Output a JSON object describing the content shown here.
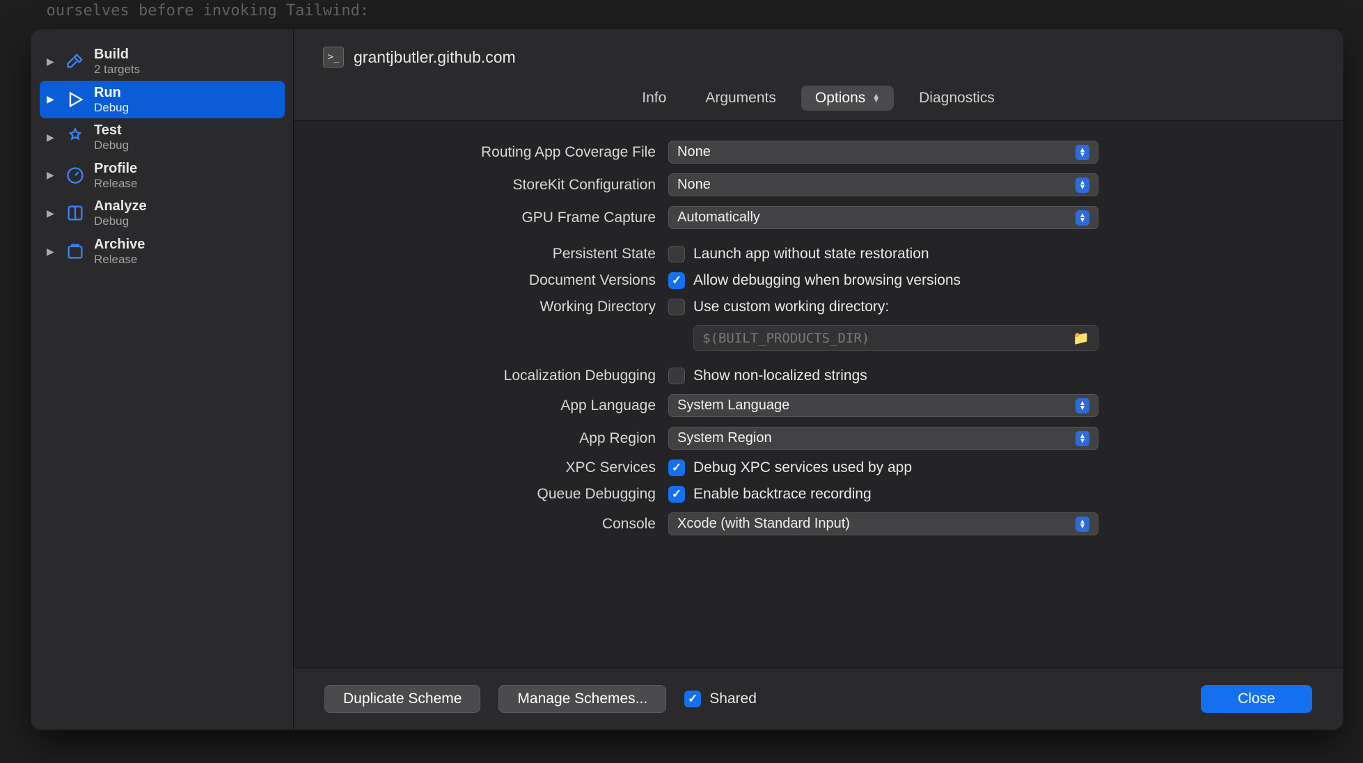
{
  "bg_code_line": "  ourselves before invoking Tailwind:",
  "sidebar": {
    "items": [
      {
        "title": "Build",
        "sub": "2 targets"
      },
      {
        "title": "Run",
        "sub": "Debug"
      },
      {
        "title": "Test",
        "sub": "Debug"
      },
      {
        "title": "Profile",
        "sub": "Release"
      },
      {
        "title": "Analyze",
        "sub": "Debug"
      },
      {
        "title": "Archive",
        "sub": "Release"
      }
    ]
  },
  "header": {
    "scheme_name": "grantjbutler.github.com"
  },
  "tabs": {
    "info": "Info",
    "arguments": "Arguments",
    "options": "Options",
    "diagnostics": "Diagnostics"
  },
  "options": {
    "routing_label": "Routing App Coverage File",
    "routing_value": "None",
    "storekit_label": "StoreKit Configuration",
    "storekit_value": "None",
    "gpu_label": "GPU Frame Capture",
    "gpu_value": "Automatically",
    "persistent_label": "Persistent State",
    "persistent_check": "Launch app without state restoration",
    "docver_label": "Document Versions",
    "docver_check": "Allow debugging when browsing versions",
    "workdir_label": "Working Directory",
    "workdir_check": "Use custom working directory:",
    "workdir_placeholder": "$(BUILT_PRODUCTS_DIR)",
    "locdebug_label": "Localization Debugging",
    "locdebug_check": "Show non-localized strings",
    "applang_label": "App Language",
    "applang_value": "System Language",
    "appregion_label": "App Region",
    "appregion_value": "System Region",
    "xpc_label": "XPC Services",
    "xpc_check": "Debug XPC services used by app",
    "queue_label": "Queue Debugging",
    "queue_check": "Enable backtrace recording",
    "console_label": "Console",
    "console_value": "Xcode (with Standard Input)"
  },
  "footer": {
    "duplicate": "Duplicate Scheme",
    "manage": "Manage Schemes...",
    "shared": "Shared",
    "close": "Close"
  }
}
